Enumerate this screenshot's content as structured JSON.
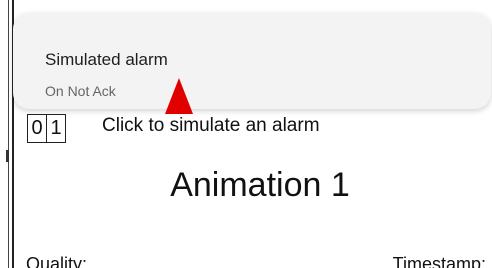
{
  "notification": {
    "title": "Simulated alarm",
    "status": "On Not Ack"
  },
  "alarm_panel": {
    "digits": [
      "0",
      "1"
    ],
    "click_label": "Click to simulate an alarm",
    "animation_title": "Animation 1",
    "quality_label": "Quality:",
    "timestamp_label": "Timestamp:"
  },
  "pointer": {
    "icon": "red-arrow-pointer-icon",
    "color": "#e00000"
  }
}
